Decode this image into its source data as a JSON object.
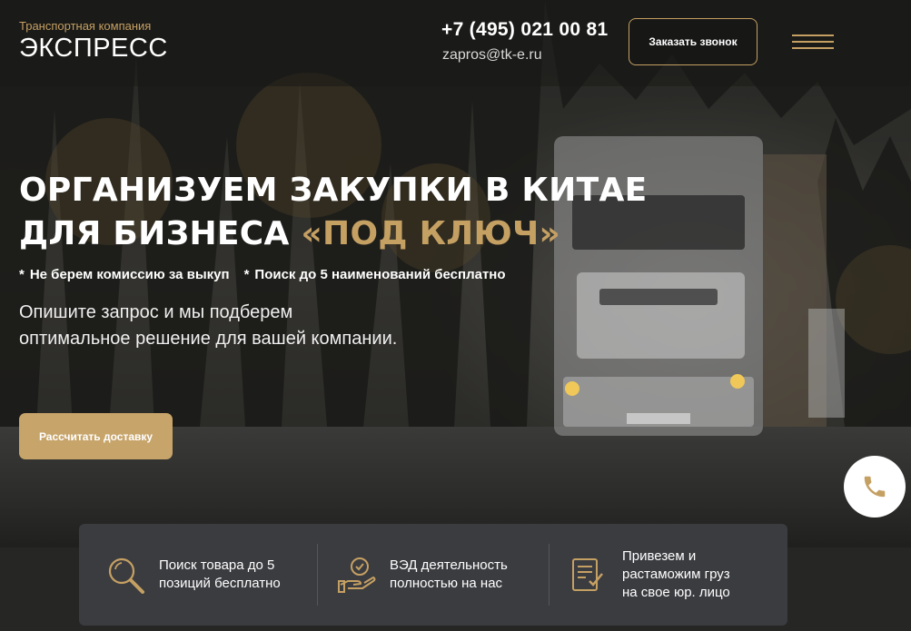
{
  "header": {
    "logo_subtitle": "Транспортная компания",
    "logo_title": "ЭКСПРЕСС",
    "phone": "+7 (495) 021 00 81",
    "email": "zapros@tk-e.ru",
    "callback_label": "Заказать звонок",
    "menu_icon": "hamburger-menu-icon"
  },
  "hero": {
    "headline_line1": "ОРГАНИЗУЕМ ЗАКУПКИ В КИТАЕ",
    "headline_line2_prefix": "ДЛЯ БИЗНЕСА ",
    "headline_accent": "«ПОД КЛЮЧ»",
    "perks": [
      {
        "marker": "*",
        "text": "Не берем комиссию за выкуп"
      },
      {
        "marker": "*",
        "text": "Поиск до 5 наименований бесплатно"
      }
    ],
    "lead_line1": "Опишите запрос и мы подберем",
    "lead_line2": "оптимальное решение для вашей компании.",
    "cta_label": "Рассчитать доставку"
  },
  "call_fab_icon": "phone-icon",
  "features": [
    {
      "icon": "search-magnifier-icon",
      "line1": "Поиск товара до 5",
      "line2": "позиций бесплатно"
    },
    {
      "icon": "badge-hand-icon",
      "line1": "ВЭД деятельность",
      "line2": "полностью на нас"
    },
    {
      "icon": "document-check-icon",
      "line1": "Привезем и",
      "line2": "растаможим груз",
      "line3": "на свое юр. лицо"
    }
  ],
  "colors": {
    "accent": "#c5a063",
    "button_fill": "#c7a46a",
    "panel": "#3b3c40",
    "background": "#262624"
  }
}
